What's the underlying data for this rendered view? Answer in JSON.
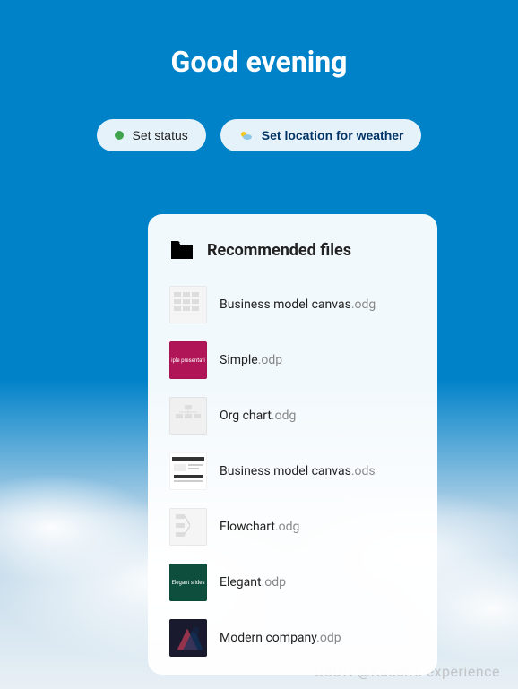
{
  "greeting": "Good evening",
  "pills": {
    "status": {
      "label": "Set status",
      "dot_color": "#3fa34d"
    },
    "weather": {
      "label": "Set location for weather"
    }
  },
  "card": {
    "title": "Recommended files",
    "files": [
      {
        "name": "Business model canvas",
        "ext": ".odg",
        "thumb_bg": "#f5f5f5",
        "thumb_text": "",
        "thumb_color": "#999"
      },
      {
        "name": "Simple",
        "ext": ".odp",
        "thumb_bg": "#b01657",
        "thumb_text": "iple presentati",
        "thumb_color": "#fff"
      },
      {
        "name": "Org chart",
        "ext": ".odg",
        "thumb_bg": "#f0f0f0",
        "thumb_text": "",
        "thumb_color": "#999"
      },
      {
        "name": "Business model canvas",
        "ext": ".ods",
        "thumb_bg": "#ffffff",
        "thumb_text": "",
        "thumb_color": "#333"
      },
      {
        "name": "Flowchart",
        "ext": ".odg",
        "thumb_bg": "#f5f5f5",
        "thumb_text": "",
        "thumb_color": "#999"
      },
      {
        "name": "Elegant",
        "ext": ".odp",
        "thumb_bg": "#0d4f3c",
        "thumb_text": "Elegant slides",
        "thumb_color": "#fff"
      },
      {
        "name": "Modern company",
        "ext": ".odp",
        "thumb_bg": "#1a1a2e",
        "thumb_text": "",
        "thumb_color": "#e94560"
      }
    ]
  },
  "watermark": "CSDN @Kasen's experience"
}
